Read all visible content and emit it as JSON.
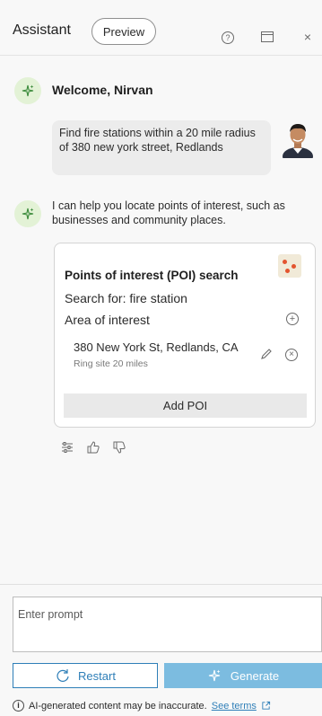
{
  "header": {
    "title": "Assistant",
    "preview_label": "Preview",
    "help_icon": "help-circle-icon",
    "dock_icon": "dock-panel-icon",
    "close_icon": "close-icon"
  },
  "conversation": {
    "welcome": "Welcome, Nirvan",
    "user_message": "Find fire stations within a 20 mile radius of 380 new york street, Redlands",
    "assistant_message": "I can help you locate points of interest, such as businesses and community places.",
    "poi_card": {
      "title": "Points of interest (POI) search",
      "search_for": "Search for: fire station",
      "area_label": "Area of interest",
      "address": "380 New York St, Redlands, CA",
      "ring": "Ring site 20 miles",
      "add_button": "Add POI"
    },
    "feedback_icons": [
      "settings-sliders-icon",
      "thumbs-up-icon",
      "thumbs-down-icon"
    ]
  },
  "footer": {
    "prompt_placeholder": "Enter prompt",
    "restart_label": "Restart",
    "generate_label": "Generate",
    "disclaimer_text": "AI-generated content may be inaccurate.",
    "terms_link": "See terms"
  },
  "colors": {
    "accent": "#2f7fb8",
    "generate_bg": "#7cbce0",
    "ai_avatar_bg": "#e3f2d6"
  }
}
